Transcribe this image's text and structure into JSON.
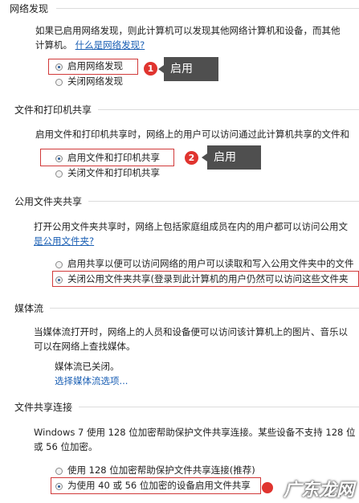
{
  "network_discovery": {
    "heading": "网络发现",
    "desc_line1": "如果已启用网络发现，则此计算机可以发现其他网络计算机和设备，而其他",
    "desc_line2_prefix": "计算机。",
    "link": "什么是网络发现?",
    "option_on": "启用网络发现",
    "option_off": "关闭网络发现",
    "badge": "1",
    "callout": "启用"
  },
  "file_printer_sharing": {
    "heading": "文件和打印机共享",
    "desc": "启用文件和打印机共享时，网络上的用户可以访问通过此计算机共享的文件和",
    "option_on": "启用文件和打印机共享",
    "option_off": "关闭文件和打印机共享",
    "badge": "2",
    "callout": "启用"
  },
  "public_folder_sharing": {
    "heading": "公用文件夹共享",
    "desc": "打开公用文件夹共享时，网络上包括家庭组成员在内的用户都可以访问公用文",
    "link": "是公用文件夹?",
    "option_on": "启用共享以便可以访问网络的用户可以读取和写入公用文件夹中的文件",
    "option_off": "关闭公用文件夹共享(登录到此计算机的用户仍然可以访问这些文件夹"
  },
  "media_streaming": {
    "heading": "媒体流",
    "desc_line1": "当媒体流打开时，网络上的人员和设备便可以访问该计算机上的图片、音乐以",
    "desc_line2": "可以在网络上查找媒体。",
    "status": "媒体流已关闭。",
    "link": "选择媒体流选项..."
  },
  "file_sharing_connections": {
    "heading": "文件共享连接",
    "desc_line1": "Windows 7 使用 128 位加密帮助保护文件共享连接。某些设备不支持 128 位",
    "desc_line2": "或 56 位加密。",
    "option_128": "使用 128 位加密帮助保护文件共享连接(推荐)",
    "option_40_56": "为使用 40 或 56 位加密的设备启用文件共享"
  },
  "watermark": "广东龙网",
  "colors": {
    "accent_red": "#e0342f",
    "link_blue": "#1a5fb4",
    "callout_bg": "#4f4f4f"
  }
}
